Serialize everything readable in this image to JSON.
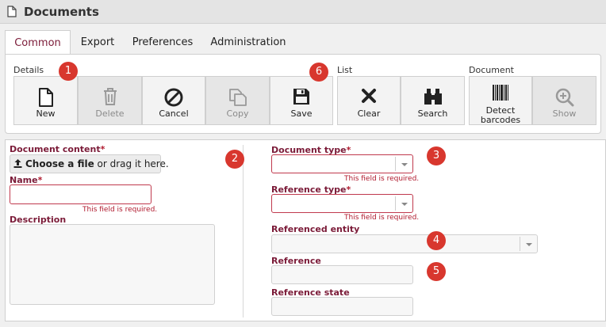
{
  "window": {
    "title": "Documents",
    "icon": "document-icon"
  },
  "tabs": [
    {
      "label": "Common",
      "active": true
    },
    {
      "label": "Export",
      "active": false
    },
    {
      "label": "Preferences",
      "active": false
    },
    {
      "label": "Administration",
      "active": false
    }
  ],
  "ribbon": {
    "groups": {
      "details": "Details",
      "list": "List",
      "document": "Document"
    },
    "buttons": {
      "new": {
        "label": "New",
        "icon": "new-document-icon",
        "enabled": true
      },
      "delete": {
        "label": "Delete",
        "icon": "trash-icon",
        "enabled": false
      },
      "cancel": {
        "label": "Cancel",
        "icon": "cancel-icon",
        "enabled": true
      },
      "copy": {
        "label": "Copy",
        "icon": "copy-icon",
        "enabled": false
      },
      "save": {
        "label": "Save",
        "icon": "floppy-disk-icon",
        "enabled": true
      },
      "clear": {
        "label": "Clear",
        "icon": "x-icon",
        "enabled": true
      },
      "search": {
        "label": "Search",
        "icon": "binoculars-icon",
        "enabled": true
      },
      "detect_barcodes": {
        "label_line1": "Detect",
        "label_line2": "barcodes",
        "icon": "barcode-icon",
        "enabled": true
      },
      "show": {
        "label": "Show",
        "icon": "zoom-in-icon",
        "enabled": false
      }
    }
  },
  "annotations": [
    "1",
    "2",
    "3",
    "4",
    "5",
    "6"
  ],
  "form": {
    "document_content": {
      "label": "Document content",
      "required_mark": "*",
      "choose_bold": "Choose a file",
      "choose_rest": " or drag it here."
    },
    "name": {
      "label": "Name",
      "required_mark": "*",
      "value": "",
      "error": "This field is required."
    },
    "description": {
      "label": "Description",
      "value": ""
    },
    "document_type": {
      "label": "Document type",
      "required_mark": "*",
      "value": "",
      "error": "This field is required."
    },
    "reference_type": {
      "label": "Reference type",
      "required_mark": "*",
      "value": "",
      "error": "This field is required."
    },
    "referenced_entity": {
      "label": "Referenced entity",
      "value": ""
    },
    "reference": {
      "label": "Reference",
      "value": ""
    },
    "reference_state": {
      "label": "Reference state",
      "value": ""
    }
  },
  "colors": {
    "accent": "#7b1b38",
    "error": "#b01a2e",
    "badge": "#d8372e"
  }
}
